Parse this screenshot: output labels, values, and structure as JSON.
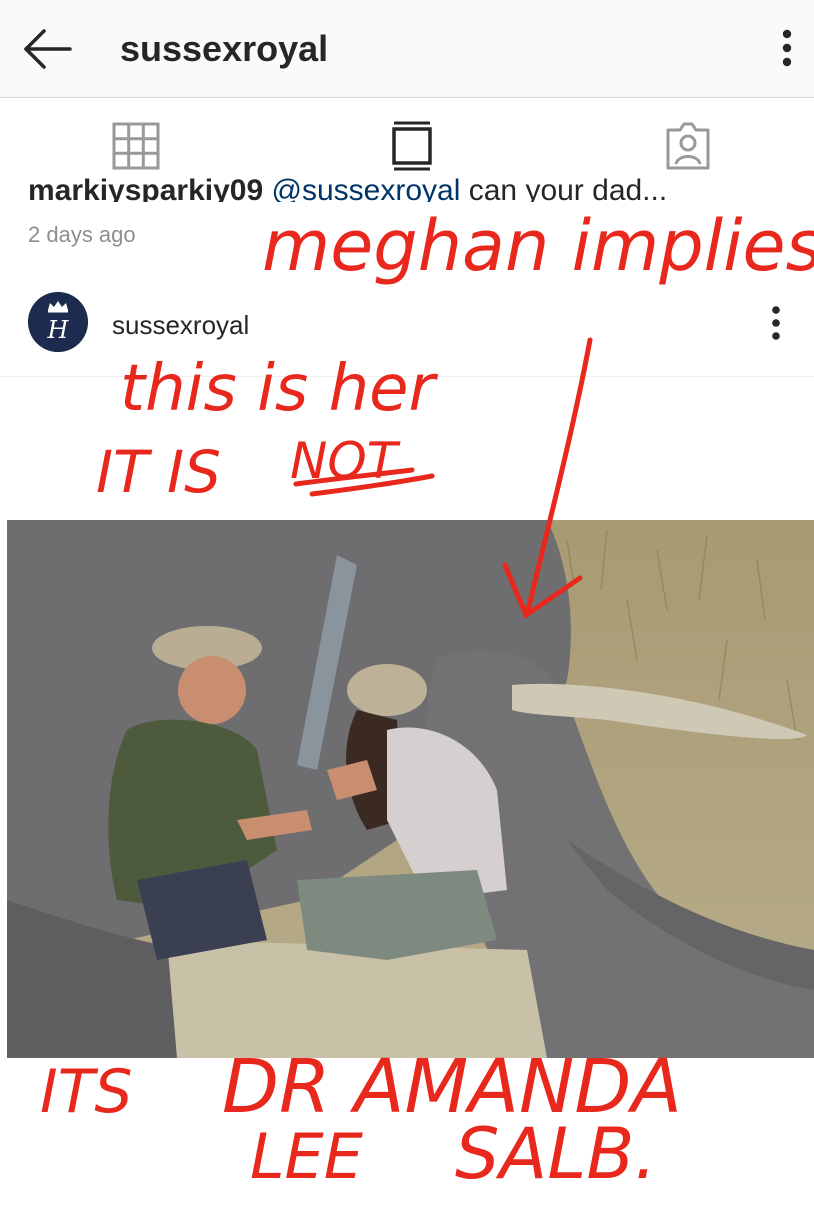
{
  "topbar": {
    "title": "sussexroyal"
  },
  "comment": {
    "username": "markiysparkiy09",
    "mention": "@sussexroyal",
    "text": "can your dad...",
    "timestamp": "2 days ago"
  },
  "post": {
    "username": "sussexroyal",
    "avatar_monogram": "H"
  },
  "annotations": {
    "line1": "meghan implies",
    "line2": "this is her",
    "line3": "IT IS",
    "line3_emph": "NOT",
    "line4a": "ITS",
    "line4b": "DR AMANDA",
    "line5a": "LEE",
    "line5b": "SALB."
  },
  "colors": {
    "annotation": "#e8281c",
    "mention": "#003569"
  },
  "icons": [
    "back-arrow-icon",
    "more-vertical-icon",
    "grid-icon",
    "feed-icon",
    "tagged-user-icon"
  ]
}
